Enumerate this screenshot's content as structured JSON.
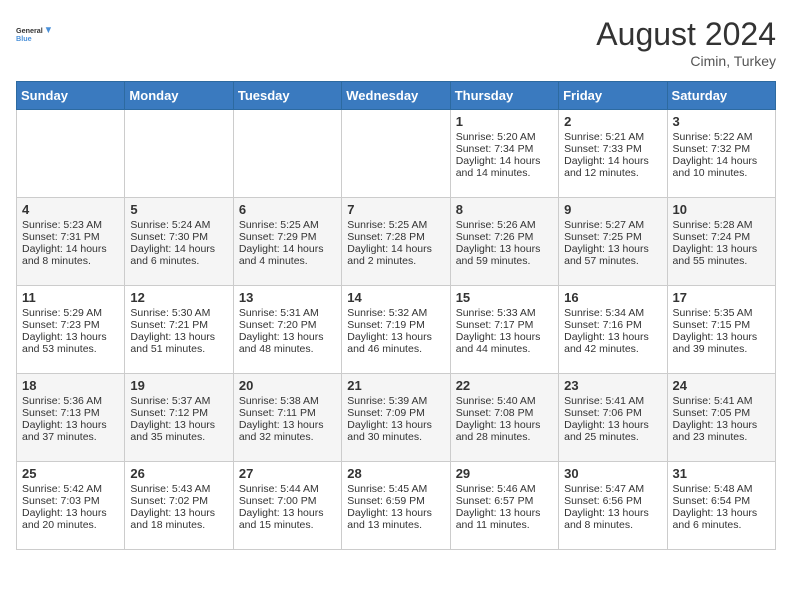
{
  "header": {
    "logo_line1": "General",
    "logo_line2": "Blue",
    "month_year": "August 2024",
    "location": "Cimin, Turkey"
  },
  "weekdays": [
    "Sunday",
    "Monday",
    "Tuesday",
    "Wednesday",
    "Thursday",
    "Friday",
    "Saturday"
  ],
  "weeks": [
    [
      {
        "day": "",
        "text": ""
      },
      {
        "day": "",
        "text": ""
      },
      {
        "day": "",
        "text": ""
      },
      {
        "day": "",
        "text": ""
      },
      {
        "day": "1",
        "text": "Sunrise: 5:20 AM\nSunset: 7:34 PM\nDaylight: 14 hours and 14 minutes."
      },
      {
        "day": "2",
        "text": "Sunrise: 5:21 AM\nSunset: 7:33 PM\nDaylight: 14 hours and 12 minutes."
      },
      {
        "day": "3",
        "text": "Sunrise: 5:22 AM\nSunset: 7:32 PM\nDaylight: 14 hours and 10 minutes."
      }
    ],
    [
      {
        "day": "4",
        "text": "Sunrise: 5:23 AM\nSunset: 7:31 PM\nDaylight: 14 hours and 8 minutes."
      },
      {
        "day": "5",
        "text": "Sunrise: 5:24 AM\nSunset: 7:30 PM\nDaylight: 14 hours and 6 minutes."
      },
      {
        "day": "6",
        "text": "Sunrise: 5:25 AM\nSunset: 7:29 PM\nDaylight: 14 hours and 4 minutes."
      },
      {
        "day": "7",
        "text": "Sunrise: 5:25 AM\nSunset: 7:28 PM\nDaylight: 14 hours and 2 minutes."
      },
      {
        "day": "8",
        "text": "Sunrise: 5:26 AM\nSunset: 7:26 PM\nDaylight: 13 hours and 59 minutes."
      },
      {
        "day": "9",
        "text": "Sunrise: 5:27 AM\nSunset: 7:25 PM\nDaylight: 13 hours and 57 minutes."
      },
      {
        "day": "10",
        "text": "Sunrise: 5:28 AM\nSunset: 7:24 PM\nDaylight: 13 hours and 55 minutes."
      }
    ],
    [
      {
        "day": "11",
        "text": "Sunrise: 5:29 AM\nSunset: 7:23 PM\nDaylight: 13 hours and 53 minutes."
      },
      {
        "day": "12",
        "text": "Sunrise: 5:30 AM\nSunset: 7:21 PM\nDaylight: 13 hours and 51 minutes."
      },
      {
        "day": "13",
        "text": "Sunrise: 5:31 AM\nSunset: 7:20 PM\nDaylight: 13 hours and 48 minutes."
      },
      {
        "day": "14",
        "text": "Sunrise: 5:32 AM\nSunset: 7:19 PM\nDaylight: 13 hours and 46 minutes."
      },
      {
        "day": "15",
        "text": "Sunrise: 5:33 AM\nSunset: 7:17 PM\nDaylight: 13 hours and 44 minutes."
      },
      {
        "day": "16",
        "text": "Sunrise: 5:34 AM\nSunset: 7:16 PM\nDaylight: 13 hours and 42 minutes."
      },
      {
        "day": "17",
        "text": "Sunrise: 5:35 AM\nSunset: 7:15 PM\nDaylight: 13 hours and 39 minutes."
      }
    ],
    [
      {
        "day": "18",
        "text": "Sunrise: 5:36 AM\nSunset: 7:13 PM\nDaylight: 13 hours and 37 minutes."
      },
      {
        "day": "19",
        "text": "Sunrise: 5:37 AM\nSunset: 7:12 PM\nDaylight: 13 hours and 35 minutes."
      },
      {
        "day": "20",
        "text": "Sunrise: 5:38 AM\nSunset: 7:11 PM\nDaylight: 13 hours and 32 minutes."
      },
      {
        "day": "21",
        "text": "Sunrise: 5:39 AM\nSunset: 7:09 PM\nDaylight: 13 hours and 30 minutes."
      },
      {
        "day": "22",
        "text": "Sunrise: 5:40 AM\nSunset: 7:08 PM\nDaylight: 13 hours and 28 minutes."
      },
      {
        "day": "23",
        "text": "Sunrise: 5:41 AM\nSunset: 7:06 PM\nDaylight: 13 hours and 25 minutes."
      },
      {
        "day": "24",
        "text": "Sunrise: 5:41 AM\nSunset: 7:05 PM\nDaylight: 13 hours and 23 minutes."
      }
    ],
    [
      {
        "day": "25",
        "text": "Sunrise: 5:42 AM\nSunset: 7:03 PM\nDaylight: 13 hours and 20 minutes."
      },
      {
        "day": "26",
        "text": "Sunrise: 5:43 AM\nSunset: 7:02 PM\nDaylight: 13 hours and 18 minutes."
      },
      {
        "day": "27",
        "text": "Sunrise: 5:44 AM\nSunset: 7:00 PM\nDaylight: 13 hours and 15 minutes."
      },
      {
        "day": "28",
        "text": "Sunrise: 5:45 AM\nSunset: 6:59 PM\nDaylight: 13 hours and 13 minutes."
      },
      {
        "day": "29",
        "text": "Sunrise: 5:46 AM\nSunset: 6:57 PM\nDaylight: 13 hours and 11 minutes."
      },
      {
        "day": "30",
        "text": "Sunrise: 5:47 AM\nSunset: 6:56 PM\nDaylight: 13 hours and 8 minutes."
      },
      {
        "day": "31",
        "text": "Sunrise: 5:48 AM\nSunset: 6:54 PM\nDaylight: 13 hours and 6 minutes."
      }
    ]
  ]
}
